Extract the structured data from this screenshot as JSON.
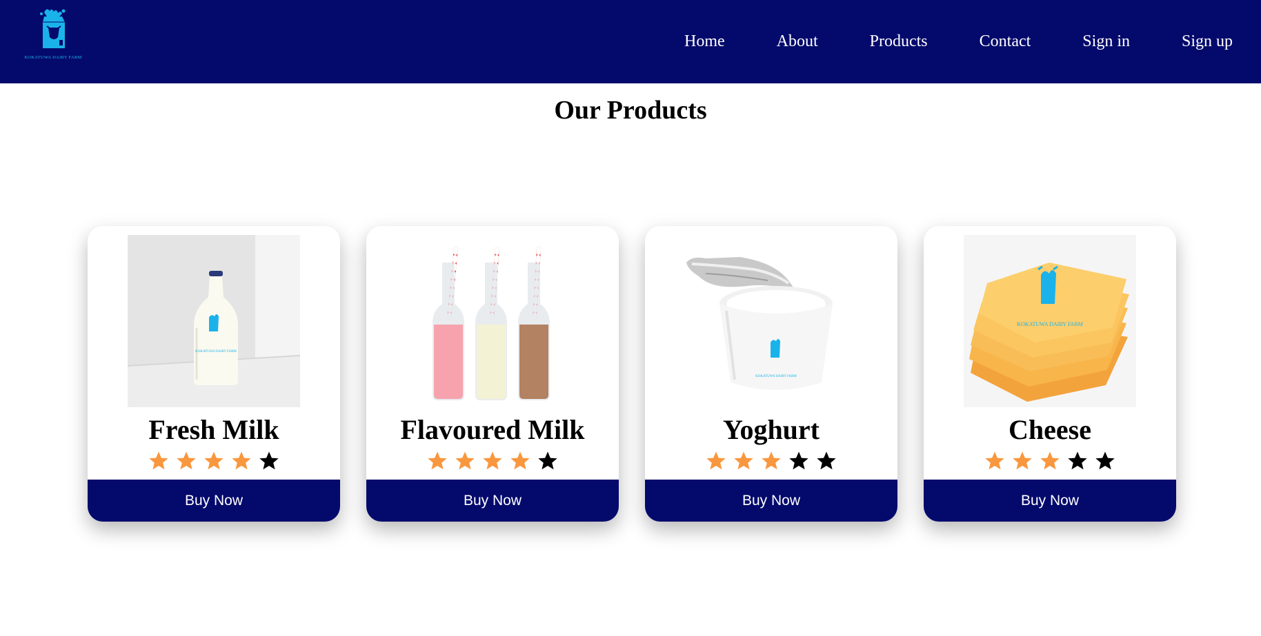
{
  "brand": {
    "logo_text": "KOKATUWA DAIRY FARM",
    "logo_color": "#1ab2ea"
  },
  "nav": {
    "items": [
      {
        "label": "Home"
      },
      {
        "label": "About"
      },
      {
        "label": "Products"
      },
      {
        "label": "Contact"
      },
      {
        "label": "Sign in"
      },
      {
        "label": "Sign up"
      }
    ]
  },
  "page": {
    "title": "Our Products"
  },
  "colors": {
    "navbar": "#040a6c",
    "star_filled": "#f9973e",
    "star_empty": "#000000",
    "button": "#040a6c"
  },
  "products": [
    {
      "name": "Fresh Milk",
      "rating": 4,
      "rating_max": 5,
      "button_label": "Buy Now",
      "image_label": "KOKATUWA DAIRY FARM"
    },
    {
      "name": "Flavoured Milk",
      "rating": 4,
      "rating_max": 5,
      "button_label": "Buy Now"
    },
    {
      "name": "Yoghurt",
      "rating": 3,
      "rating_max": 5,
      "button_label": "Buy Now",
      "image_label": "KOKATUWA DAIRY FARM"
    },
    {
      "name": "Cheese",
      "rating": 3,
      "rating_max": 5,
      "button_label": "Buy Now",
      "image_label": "KOKATUWA DAIRY FARM"
    }
  ]
}
